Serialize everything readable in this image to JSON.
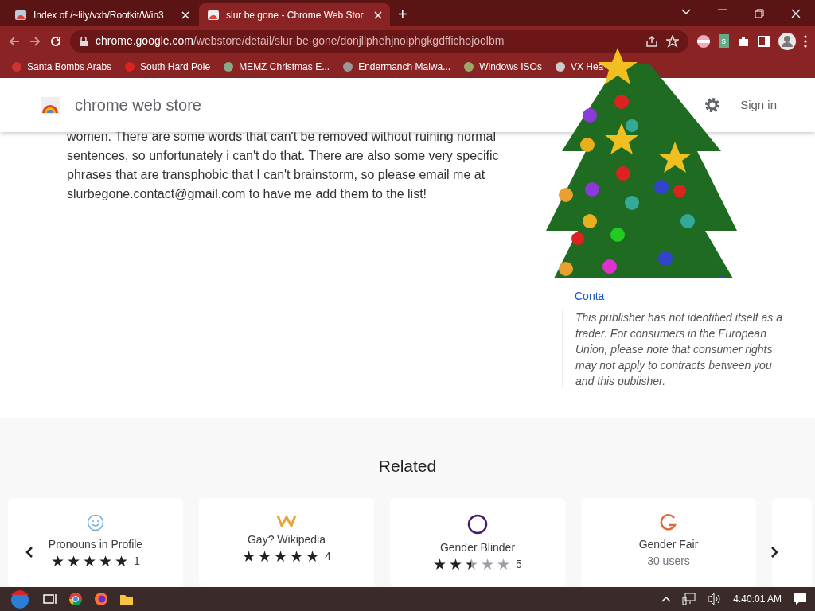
{
  "tabs": [
    {
      "title": "Index of /~lily/vxh/Rootkit/Win3",
      "selected": false
    },
    {
      "title": "slur be gone - Chrome Web Stor",
      "selected": true
    }
  ],
  "new_tab": "+",
  "address": {
    "host": "chrome.google.com",
    "path": "/webstore/detail/slur-be-gone/donjllphehjnoiphgkgdffichojoolbm"
  },
  "extension_badge": "s",
  "bookmarks": [
    "Santa Bombs Arabs",
    "South Hard Pole",
    "MEMZ Christmas E...",
    "Endermanch Malwa...",
    "Windows ISOs",
    "VX Hea"
  ],
  "store": {
    "title": "chrome web store",
    "sign_in": "Sign in"
  },
  "description": "women. There are some words that can't be removed without ruining normal sentences, so unfortunately i can't do that. There are also some very specific phrases that are transphobic that I can't brainstorm, so please email me at slurbegone.contact@gmail.com to have me add them to the list!",
  "contact_link": "Conta",
  "trader_notice": "This publisher has not identified itself as a trader. For consumers in the European Union, please note that consumer rights may not apply to contracts between you and this publisher.",
  "related": {
    "title": "Related",
    "items": [
      {
        "name": "Pronouns in Profile",
        "kind": "rated",
        "stars": 5,
        "count": "1"
      },
      {
        "name": "Gay? Wikipedia",
        "kind": "rated",
        "stars": 5,
        "count": "4"
      },
      {
        "name": "Gender Blinder",
        "kind": "rated",
        "stars": 2.5,
        "count": "5"
      },
      {
        "name": "Gender Fair",
        "kind": "users",
        "users": "30 users"
      }
    ]
  },
  "taskbar": {
    "time": "4:40:01 AM"
  }
}
